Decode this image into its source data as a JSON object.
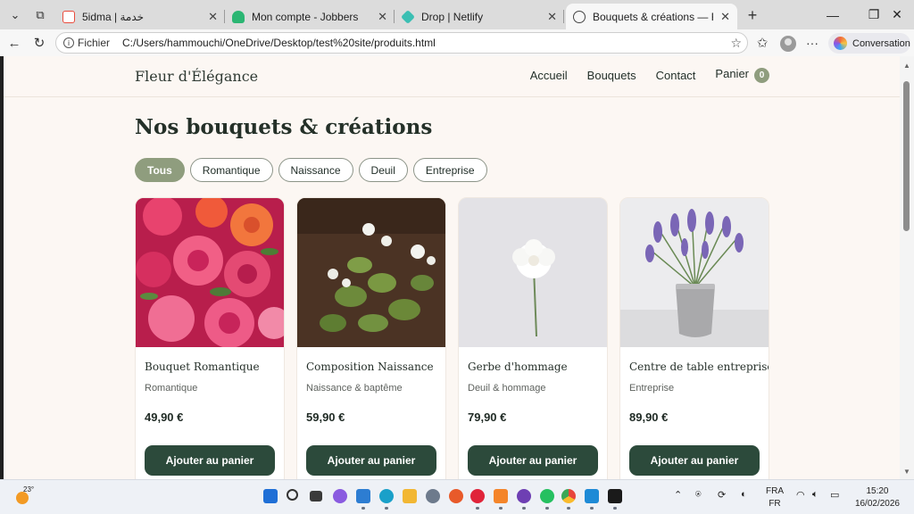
{
  "browser": {
    "tabs": [
      {
        "title": "5idma | خدمة",
        "favicon_color": "#e94b3c",
        "active": false
      },
      {
        "title": "Mon compte - Jobbers",
        "favicon_color": "#2bb673",
        "active": false
      },
      {
        "title": "Drop | Netlify",
        "favicon_color": "#3bbfb3",
        "active": false
      },
      {
        "title": "Bouquets & créations — Fleur d'Élégance",
        "favicon_color": "#555555",
        "active": true
      }
    ],
    "address_scheme": "Fichier",
    "address_url": "C:/Users/hammouchi/OneDrive/Desktop/test%20site/produits.html",
    "copilot_label": "Conversation"
  },
  "site": {
    "brand": "Fleur d'Élégance",
    "nav": [
      "Accueil",
      "Bouquets",
      "Contact"
    ],
    "cart_label": "Panier",
    "cart_count": "0",
    "page_title": "Nos bouquets & créations",
    "filters": [
      {
        "label": "Tous",
        "active": true
      },
      {
        "label": "Romantique",
        "active": false
      },
      {
        "label": "Naissance",
        "active": false
      },
      {
        "label": "Deuil",
        "active": false
      },
      {
        "label": "Entreprise",
        "active": false
      }
    ],
    "products": [
      {
        "name": "Bouquet Romantique",
        "category": "Romantique",
        "price": "49,90 €",
        "button": "Ajouter au panier",
        "image": "roses"
      },
      {
        "name": "Composition Naissance",
        "category": "Naissance & baptême",
        "price": "59,90 €",
        "button": "Ajouter au panier",
        "image": "clover"
      },
      {
        "name": "Gerbe d'hommage",
        "category": "Deuil & hommage",
        "price": "79,90 €",
        "button": "Ajouter au panier",
        "image": "white-flower"
      },
      {
        "name": "Centre de table entreprise",
        "category": "Entreprise",
        "price": "89,90 €",
        "button": "Ajouter au panier",
        "image": "lavender"
      }
    ]
  },
  "taskbar": {
    "temperature": "23°",
    "language_top": "FRA",
    "language_bottom": "FR",
    "time": "15:20",
    "date": "16/02/2026"
  }
}
